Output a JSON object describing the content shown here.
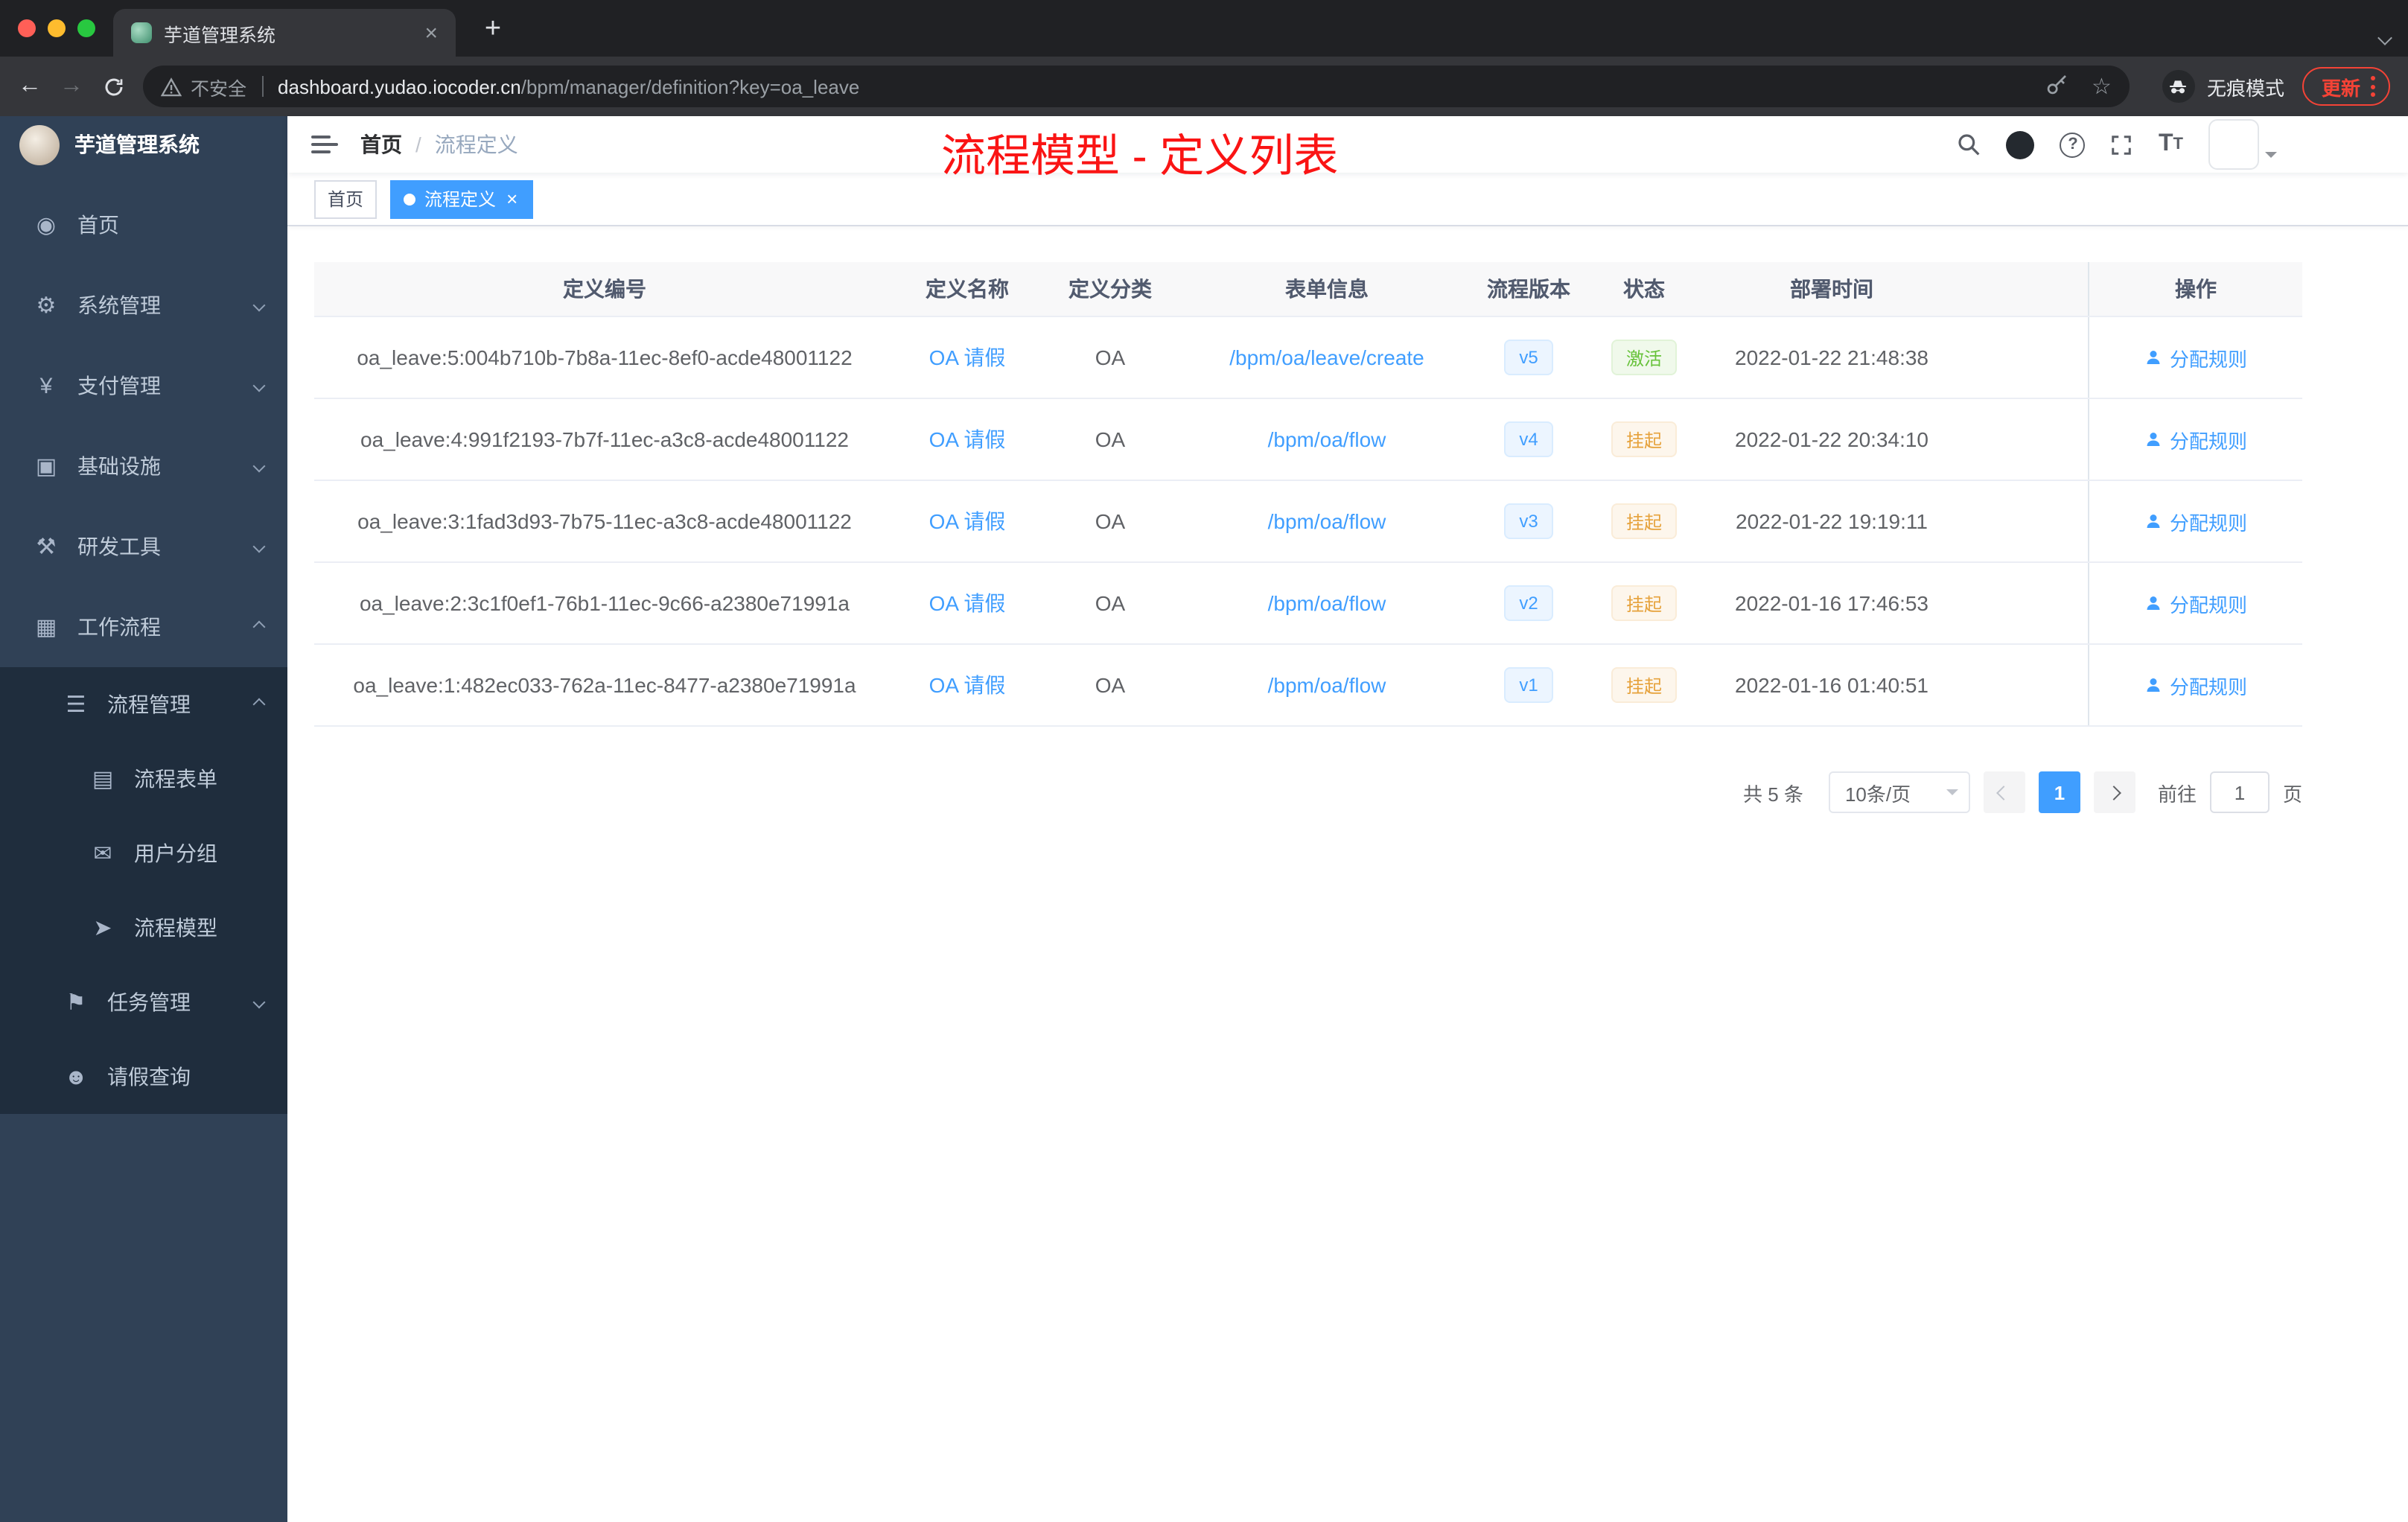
{
  "browser": {
    "tab_title": "芋道管理系统",
    "security_label": "不安全",
    "url_host": "dashboard.yudao.iocoder.cn",
    "url_path": "/bpm/manager/definition?key=oa_leave",
    "incognito_label": "无痕模式",
    "update_label": "更新"
  },
  "icons": {
    "close": "×",
    "new_tab": "+",
    "back": "←",
    "forward": "→",
    "star": "☆",
    "help": "?",
    "font_size_large": "T",
    "font_size_small": "T"
  },
  "sidebar": {
    "logo_title": "芋道管理系统",
    "items": [
      {
        "key": "home",
        "label": "首页",
        "glyph": "◉"
      },
      {
        "key": "system-management",
        "label": "系统管理",
        "glyph": "⚙"
      },
      {
        "key": "payment-management",
        "label": "支付管理",
        "glyph": "¥"
      },
      {
        "key": "infrastructure",
        "label": "基础设施",
        "glyph": "▣"
      },
      {
        "key": "devtools",
        "label": "研发工具",
        "glyph": "⚒"
      },
      {
        "key": "workflow",
        "label": "工作流程",
        "glyph": "▦"
      },
      {
        "key": "process-management",
        "label": "流程管理",
        "glyph": "☰"
      },
      {
        "key": "process-form",
        "label": "流程表单",
        "glyph": "▤"
      },
      {
        "key": "user-group",
        "label": "用户分组",
        "glyph": "✉"
      },
      {
        "key": "process-model",
        "label": "流程模型",
        "glyph": "➤"
      },
      {
        "key": "task-management",
        "label": "任务管理",
        "glyph": "⚑"
      },
      {
        "key": "leave-query",
        "label": "请假查询",
        "glyph": "☻"
      }
    ]
  },
  "header": {
    "breadcrumb_home": "首页",
    "breadcrumb_sep": "/",
    "breadcrumb_current": "流程定义",
    "annotation": "流程模型 - 定义列表"
  },
  "tags": {
    "home": "首页",
    "current": "流程定义"
  },
  "table": {
    "columns": [
      "定义编号",
      "定义名称",
      "定义分类",
      "表单信息",
      "流程版本",
      "状态",
      "部署时间",
      "操作"
    ],
    "rows": [
      {
        "id": "oa_leave:5:004b710b-7b8a-11ec-8ef0-acde48001122",
        "name": "OA 请假",
        "category": "OA",
        "form": "/bpm/oa/leave/create",
        "version": "v5",
        "status": "激活",
        "status_type": "success",
        "deployed_at": "2022-01-22 21:48:38",
        "action": "分配规则"
      },
      {
        "id": "oa_leave:4:991f2193-7b7f-11ec-a3c8-acde48001122",
        "name": "OA 请假",
        "category": "OA",
        "form": "/bpm/oa/flow",
        "version": "v4",
        "status": "挂起",
        "status_type": "warning",
        "deployed_at": "2022-01-22 20:34:10",
        "action": "分配规则"
      },
      {
        "id": "oa_leave:3:1fad3d93-7b75-11ec-a3c8-acde48001122",
        "name": "OA 请假",
        "category": "OA",
        "form": "/bpm/oa/flow",
        "version": "v3",
        "status": "挂起",
        "status_type": "warning",
        "deployed_at": "2022-01-22 19:19:11",
        "action": "分配规则"
      },
      {
        "id": "oa_leave:2:3c1f0ef1-76b1-11ec-9c66-a2380e71991a",
        "name": "OA 请假",
        "category": "OA",
        "form": "/bpm/oa/flow",
        "version": "v2",
        "status": "挂起",
        "status_type": "warning",
        "deployed_at": "2022-01-16 17:46:53",
        "action": "分配规则"
      },
      {
        "id": "oa_leave:1:482ec033-762a-11ec-8477-a2380e71991a",
        "name": "OA 请假",
        "category": "OA",
        "form": "/bpm/oa/flow",
        "version": "v1",
        "status": "挂起",
        "status_type": "warning",
        "deployed_at": "2022-01-16 01:40:51",
        "action": "分配规则"
      }
    ]
  },
  "pagination": {
    "total": "共 5 条",
    "page_size": "10条/页",
    "page": "1",
    "goto_label": "前往",
    "goto_value": "1",
    "page_unit": "页"
  },
  "colors": {
    "accent_blue": "#409eff",
    "annotation_red": "#fa1414",
    "active_green": "#67c23a",
    "suspended_orange": "#e6a23c",
    "sidebar_bg": "#304156",
    "submenu_bg": "#1f2d3d",
    "tag_version_bg": "#ecf5ff",
    "status_active_bg": "#f0f9eb",
    "status_suspended_bg": "#fdf6ec"
  }
}
